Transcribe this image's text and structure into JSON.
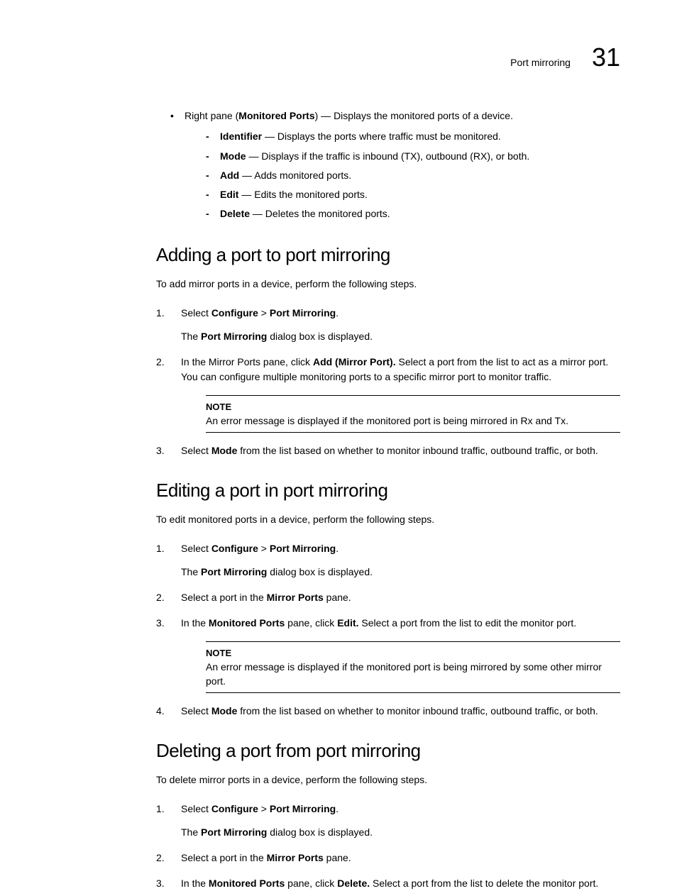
{
  "header": {
    "text": "Port mirroring",
    "number": "31"
  },
  "topBullet": {
    "main_pre": "Right pane (",
    "main_bold": "Monitored Ports",
    "main_post": ") — Displays the monitored ports of a device.",
    "dashes": [
      {
        "bold": "Identifier",
        "text": " — Displays the ports where traffic must be monitored."
      },
      {
        "bold": "Mode",
        "text": " — Displays if the traffic is inbound (TX), outbound (RX), or both."
      },
      {
        "bold": "Add",
        "text": " — Adds monitored ports."
      },
      {
        "bold": "Edit",
        "text": " — Edits the monitored ports."
      },
      {
        "bold": "Delete",
        "text": " — Deletes the monitored ports."
      }
    ]
  },
  "section1": {
    "heading": "Adding a port to port mirroring",
    "intro": "To add mirror ports in a device, perform the following steps.",
    "step1_pre": "Select ",
    "step1_b1": "Configure",
    "step1_mid": " > ",
    "step1_b2": "Port Mirroring",
    "step1_post": ".",
    "step1_sub_pre": "The ",
    "step1_sub_bold": "Port Mirroring",
    "step1_sub_post": " dialog box is displayed.",
    "step2_pre": "In the Mirror Ports pane, click ",
    "step2_bold": "Add (Mirror Port).",
    "step2_post": " Select a port from the list to act as a mirror port. You can configure multiple monitoring ports to a specific mirror port to monitor traffic.",
    "note_label": "NOTE",
    "note_text": "An error message is displayed if the monitored port is being mirrored in Rx and Tx.",
    "step3_pre": "Select ",
    "step3_bold": "Mode",
    "step3_post": " from the list based on whether to monitor inbound traffic, outbound traffic, or both."
  },
  "section2": {
    "heading": "Editing a port in port mirroring",
    "intro": "To edit monitored ports in a device, perform the following steps.",
    "step1_pre": "Select ",
    "step1_b1": "Configure",
    "step1_mid": " > ",
    "step1_b2": "Port Mirroring",
    "step1_post": ".",
    "step1_sub_pre": "The ",
    "step1_sub_bold": "Port Mirroring",
    "step1_sub_post": " dialog box is displayed.",
    "step2_pre": "Select a port in the ",
    "step2_bold": "Mirror Ports",
    "step2_post": " pane.",
    "step3_pre": "In the ",
    "step3_b1": "Monitored Ports",
    "step3_mid": " pane, click ",
    "step3_b2": "Edit.",
    "step3_post": " Select a port from the list to edit the monitor port.",
    "note_label": "NOTE",
    "note_text": "An error message is displayed if the monitored port is being mirrored by some other mirror port.",
    "step4_pre": "Select ",
    "step4_bold": "Mode",
    "step4_post": " from the list based on whether to monitor inbound traffic, outbound traffic, or both."
  },
  "section3": {
    "heading": "Deleting a port from port mirroring",
    "intro": "To delete mirror ports in a device, perform the following steps.",
    "step1_pre": "Select ",
    "step1_b1": "Configure",
    "step1_mid": " > ",
    "step1_b2": "Port Mirroring",
    "step1_post": ".",
    "step1_sub_pre": "The ",
    "step1_sub_bold": "Port Mirroring",
    "step1_sub_post": " dialog box is displayed.",
    "step2_pre": "Select a port in the ",
    "step2_bold": "Mirror Ports",
    "step2_post": " pane.",
    "step3_pre": "In the ",
    "step3_b1": "Monitored Ports",
    "step3_mid": " pane, click ",
    "step3_b2": "Delete.",
    "step3_post": " Select a port from the list to delete the monitor port."
  }
}
